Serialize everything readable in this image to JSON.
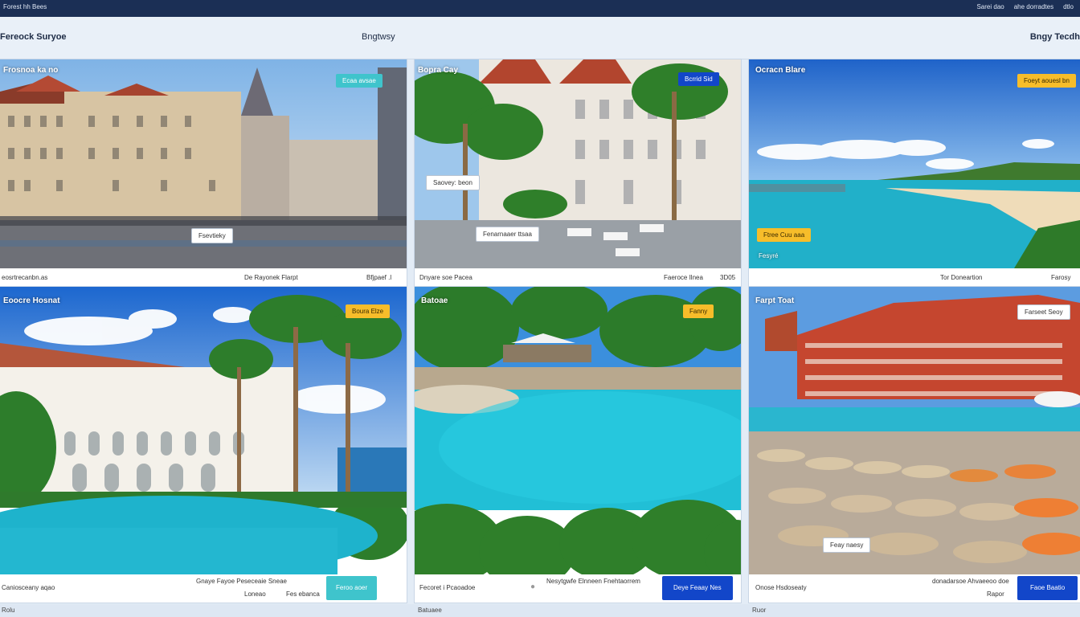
{
  "topbar": {
    "left": "Forest hh Bees",
    "right": [
      "Sarei dao",
      "ahe dorradtes",
      "dtlo"
    ]
  },
  "header": {
    "brand": "Fereock Suryoe",
    "center": "Bngtwsy",
    "right": "Bngy Tecdh"
  },
  "cards": [
    {
      "title": "Frosnoa ka no",
      "tag": "Ecaa avsae",
      "float_tag": "Fsevtieky",
      "caption_left": "eosrtrecanbn.as",
      "caption_mid": "De Rayonek Flarpt",
      "caption_right": "Bfjpaef .l"
    },
    {
      "title": "Bopra Cay",
      "tag": "Bcrrid Sid",
      "float_tag": "Saovey: beon",
      "float_tag2": "Fenarnaaer ttsaa",
      "caption_left": "Dnyare soe Pacea",
      "caption_mid": "Faeroce Ilnea",
      "caption_right": "3D05"
    },
    {
      "title": "Ocracn Blare",
      "tag": "Foeyt aouesl bn",
      "float_tag": "Ftree Cuu aaa",
      "caption_subtitle": "Fesyré",
      "caption_mid": "Tor Doneartion",
      "caption_right": "Farosy"
    },
    {
      "title": "Eoocre Hosnat",
      "tag": "Boura Elze",
      "caption_left": "Caniosceany aqao",
      "caption_mid": "Gnaye Fayoe Peseceaie Sneae",
      "caption_mid2": "Loneao",
      "caption_mid3": "Fes ebanca",
      "button": "Feroo aoer"
    },
    {
      "title": "Batoae",
      "tag": "Fanny",
      "caption_left": "Fecoret i Pcaoadoe",
      "caption_mid": "Nesytgwfe Elnneen Fnehtaorrem",
      "button": "Deye Feaay Nes"
    },
    {
      "title": "Farpt Toat",
      "tag": "Farseet Seoy",
      "float_tag": "Feay naesy",
      "caption_left": "Onose Hsdoseaty",
      "caption_mid": "donadarsoe Ahvaeeoo doe",
      "caption_mid2": "Rapor",
      "button": "Faoe Baatio"
    }
  ],
  "footer": {
    "left": "Rolu",
    "mid": "Batuaee",
    "right": "Ruor"
  },
  "colors": {
    "navy": "#1b2f55",
    "teal": "#3fc4cc",
    "blue": "#1246c9",
    "yellow": "#f7bd2a"
  }
}
